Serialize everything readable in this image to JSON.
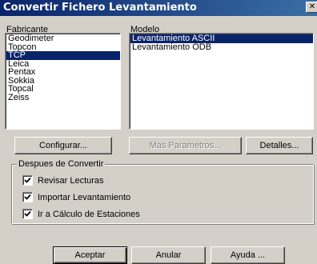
{
  "window": {
    "title": "Convertir Fichero Levantamiento",
    "close_glyph": "✕"
  },
  "fabricante": {
    "label": "Fabricante",
    "items": [
      "Geodimeter",
      "Topcon",
      "TCP",
      "Leica",
      "Pentax",
      "Sokkia",
      "Topcal",
      "Zeiss"
    ],
    "selected": "TCP"
  },
  "modelo": {
    "label": "Modelo",
    "items": [
      "Levantamiento ASCII",
      "Levantamiento ODB"
    ],
    "selected": "Levantamiento ASCII"
  },
  "buttons": {
    "configurar": "Configurar...",
    "mas_parametros": "Mas Parametros...",
    "detalles": "Detalles..."
  },
  "despues": {
    "title": "Despues de Convertir",
    "options": [
      {
        "label": "Revisar Lecturas",
        "checked": true
      },
      {
        "label": "Importar Levantamiento",
        "checked": true
      },
      {
        "label": "Ir a Cálculo de Estaciones",
        "checked": true
      }
    ]
  },
  "footer": {
    "aceptar": "Aceptar",
    "anular": "Anular",
    "ayuda": "Ayuda ..."
  }
}
